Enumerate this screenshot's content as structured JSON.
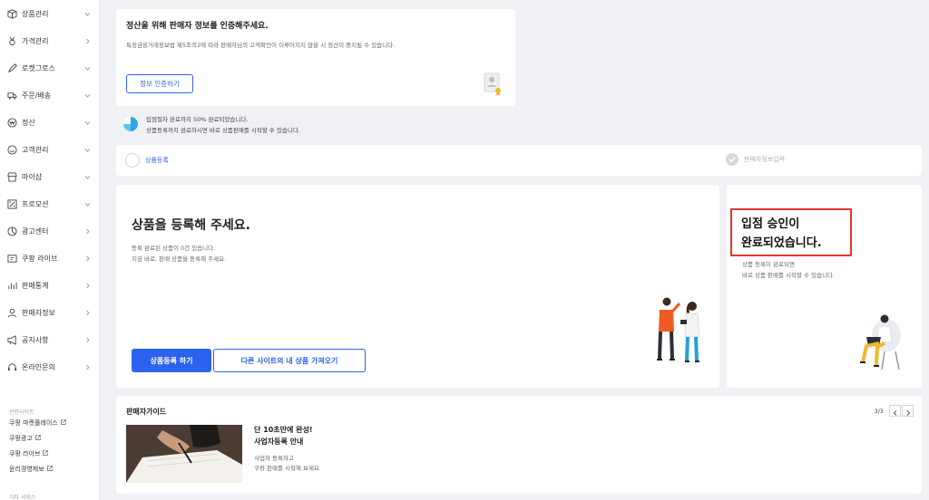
{
  "sidebar": {
    "items": [
      {
        "label": "상품관리",
        "icon": "box-icon",
        "chevron": "down"
      },
      {
        "label": "가격관리",
        "icon": "medal-icon",
        "chevron": "right"
      },
      {
        "label": "로켓그로스",
        "icon": "rocket-icon",
        "chevron": "down"
      },
      {
        "label": "주문/배송",
        "icon": "truck-icon",
        "chevron": "down"
      },
      {
        "label": "정산",
        "icon": "won-icon",
        "chevron": "down"
      },
      {
        "label": "고객관리",
        "icon": "smile-icon",
        "chevron": "down"
      },
      {
        "label": "마이샵",
        "icon": "shop-icon",
        "chevron": "down"
      },
      {
        "label": "프로모션",
        "icon": "percent-icon",
        "chevron": "down"
      },
      {
        "label": "광고센터",
        "icon": "ad-icon",
        "chevron": "right"
      },
      {
        "label": "쿠팡 라이브",
        "icon": "live-icon",
        "chevron": "right"
      },
      {
        "label": "판매통계",
        "icon": "chart-icon",
        "chevron": "right"
      },
      {
        "label": "판매자정보",
        "icon": "user-icon",
        "chevron": "right"
      },
      {
        "label": "공지사항",
        "icon": "megaphone-icon",
        "chevron": "right"
      },
      {
        "label": "온라인문의",
        "icon": "headset-icon",
        "chevron": "right"
      }
    ],
    "related_title": "관련사이트",
    "related_links": [
      "쿠팡 마켓플레이스",
      "쿠팡광고",
      "쿠팡 라이브",
      "윤리경영제보"
    ],
    "other_title": "기타 서비스"
  },
  "verify": {
    "title": "정산을 위해 판매자 정보를 인증해주세요.",
    "desc": "특정금융거래정보법 제5조의2에 따라 판매자님의 고객확인이 이루어지지 않을 시 정산이 중지될 수 있습니다.",
    "button": "정보 인증하기"
  },
  "progress": {
    "line1": "입점절차 완료까지 50% 완료되었습니다.",
    "line2": "상품등록까지 완료하시면 바로 상품판매를 시작할 수 있습니다."
  },
  "steps": {
    "step1": "상품등록",
    "step2": "판매자정보입력"
  },
  "register": {
    "title": "상품을 등록해 주세요.",
    "line1": "등록 완료된 상품이 0건 있습니다.",
    "line2": "지금 바로, 판매 상품을 등록해 주세요.",
    "primary_button": "상품등록 하기",
    "secondary_button": "다른 사이트의 내 상품 가져오기"
  },
  "approved": {
    "title_line1": "입점 승인이",
    "title_line2": "완료되었습니다.",
    "line1": "상품 등록이 완료되면",
    "line2": "바로 상품 판매를 시작할 수 있습니다."
  },
  "guide": {
    "title": "판매자가이드",
    "page": "3/3",
    "headline1": "단 10초만에 완성!",
    "headline2": "사업자등록 안내",
    "desc1": "사업자 등록하고",
    "desc2": "쿠팡 판매를 시작해 보세요"
  },
  "colors": {
    "accent": "#2b63ef",
    "highlight_border": "#e0392d",
    "background": "#eff1f5"
  }
}
